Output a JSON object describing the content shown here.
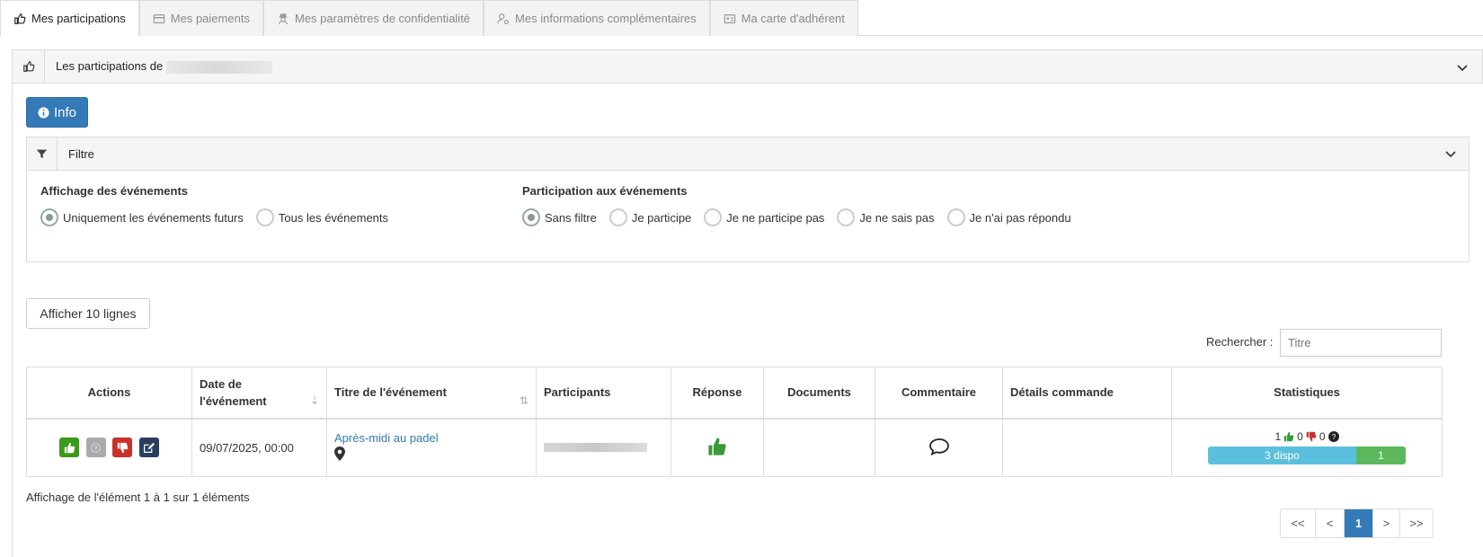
{
  "tabs": [
    {
      "label": "Mes participations",
      "icon": "thumbs-up-icon",
      "active": true
    },
    {
      "label": "Mes paiements",
      "icon": "credit-card-icon",
      "active": false
    },
    {
      "label": "Mes paramètres de confidentialité",
      "icon": "user-secret-icon",
      "active": false
    },
    {
      "label": "Mes informations complémentaires",
      "icon": "user-gear-icon",
      "active": false
    },
    {
      "label": "Ma carte d'adhérent",
      "icon": "id-card-icon",
      "active": false
    }
  ],
  "panel": {
    "title": "Les participations de"
  },
  "info_button": {
    "label": "Info"
  },
  "filter": {
    "title": "Filtre",
    "events_display": {
      "title": "Affichage des événements",
      "options": [
        "Uniquement les événements futurs",
        "Tous les événements"
      ],
      "selected": "Uniquement les événements futurs"
    },
    "participation": {
      "title": "Participation aux événements",
      "options": [
        "Sans filtre",
        "Je participe",
        "Je ne participe pas",
        "Je ne sais pas",
        "Je n'ai pas répondu"
      ],
      "selected": "Sans filtre"
    }
  },
  "page_length_button": {
    "label": "Afficher 10 lignes"
  },
  "search": {
    "label": "Rechercher :",
    "placeholder": "Titre"
  },
  "table": {
    "headers": {
      "actions": "Actions",
      "date": "Date de l'événement",
      "title": "Titre de l'événement",
      "participants": "Participants",
      "response": "Réponse",
      "documents": "Documents",
      "comment": "Commentaire",
      "order_details": "Détails commande",
      "stats": "Statistiques"
    },
    "rows": [
      {
        "date": "09/07/2025, 00:00",
        "title": "Après-midi au padel",
        "stats": {
          "yes": "1",
          "no": "0",
          "maybe": "0",
          "available": "3 dispo",
          "taken": "1",
          "available_fraction": 0.75
        }
      }
    ]
  },
  "table_info": "Affichage de l'élément 1 à 1 sur 1 éléments",
  "pagination": {
    "first": "<<",
    "prev": "<",
    "current": "1",
    "next": ">",
    "last": ">>"
  },
  "colors": {
    "primary": "#337ab7",
    "success": "#5cb85c",
    "danger": "#d9534f",
    "info": "#5bc0de",
    "thumb_green": "#3a9a3a"
  }
}
